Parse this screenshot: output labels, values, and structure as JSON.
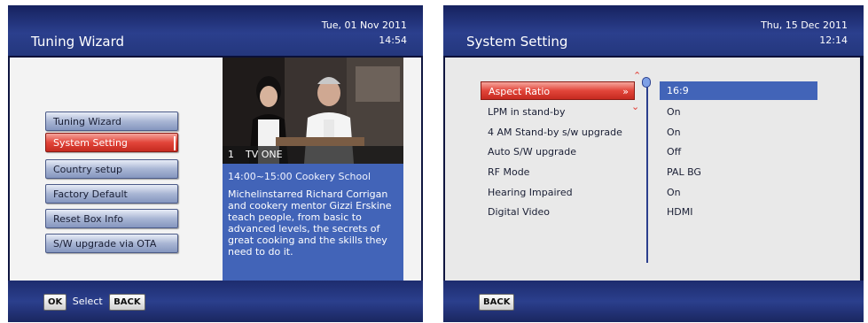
{
  "left_screen": {
    "title": "Tuning Wizard",
    "date": "Tue, 01 Nov 2011",
    "time": "14:54",
    "menu": [
      {
        "label": "Tuning Wizard",
        "active": false
      },
      {
        "label": "System Setting",
        "active": true
      },
      {
        "label": "Country setup",
        "active": false
      },
      {
        "label": "Factory Default",
        "active": false
      },
      {
        "label": "Reset Box Info",
        "active": false
      },
      {
        "label": "S/W upgrade via OTA",
        "active": false
      }
    ],
    "channel": {
      "number": "1",
      "name": "TV ONE"
    },
    "programme": "14:00~15:00  Cookery School",
    "description": "Michelinstarred Richard Corrigan and cookery mentor Gizzi Erskine teach people, from basic to advanced levels, the secrets of great cooking and the skills they need to do it.",
    "footer": {
      "ok_key": "OK",
      "select_label": "Select",
      "back_key": "BACK"
    }
  },
  "right_screen": {
    "title": "System Setting",
    "date": "Thu, 15 Dec 2011",
    "time": "12:14",
    "settings": [
      {
        "label": "Aspect Ratio",
        "value": "16:9",
        "active": true
      },
      {
        "label": "LPM in stand-by",
        "value": "On",
        "active": false
      },
      {
        "label": "4 AM Stand-by s/w upgrade",
        "value": "On",
        "active": false
      },
      {
        "label": "Auto S/W upgrade",
        "value": "Off",
        "active": false
      },
      {
        "label": "RF Mode",
        "value": "PAL BG",
        "active": false
      },
      {
        "label": "Hearing Impaired",
        "value": "On",
        "active": false
      },
      {
        "label": "Digital Video",
        "value": "HDMI",
        "active": false
      }
    ],
    "footer": {
      "back_key": "BACK"
    }
  },
  "colors": {
    "accent_red": "#e2453a",
    "highlight_blue": "#4264b8",
    "header_blue": "#2b3f8d"
  },
  "icons": [
    "up-arrow-icon",
    "down-arrow-icon",
    "right-arrow-icon",
    "scroll-indicator-icon"
  ]
}
